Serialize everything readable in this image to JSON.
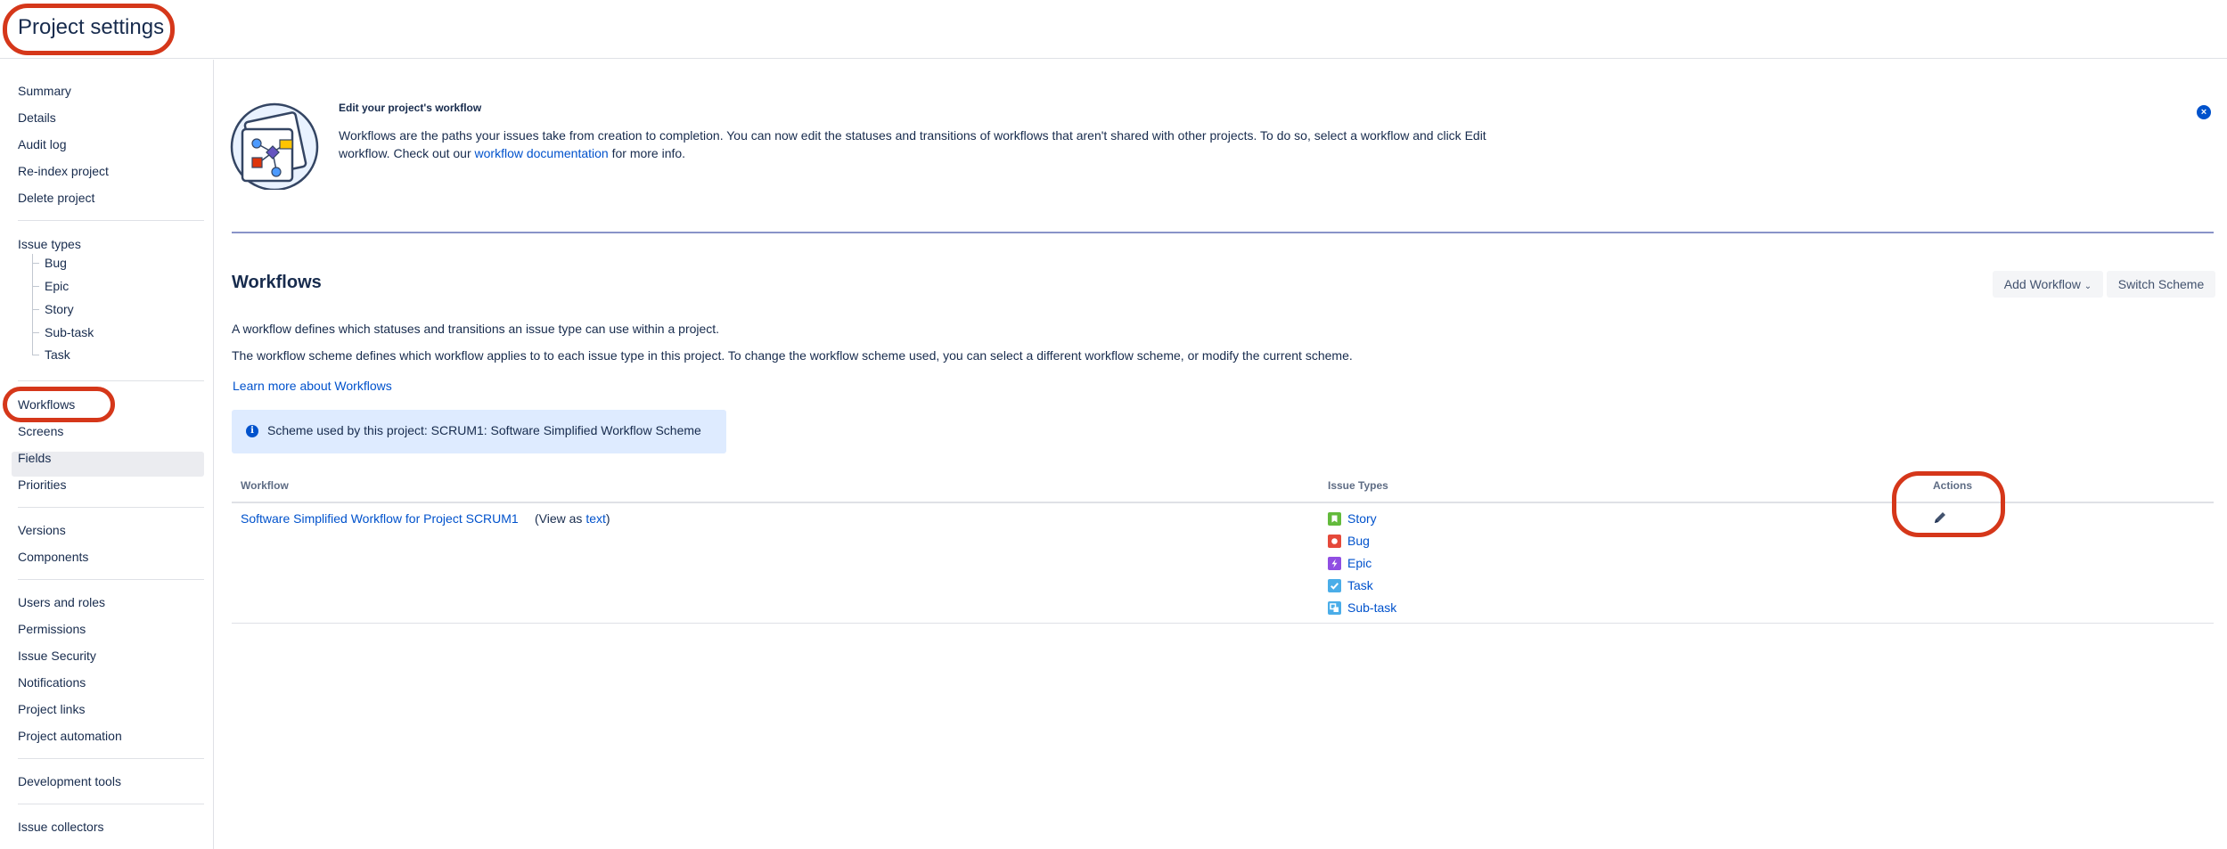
{
  "header": {
    "title": "Project settings"
  },
  "sidebar": {
    "group1": [
      "Summary",
      "Details",
      "Audit log",
      "Re-index project",
      "Delete project"
    ],
    "issue_types_label": "Issue types",
    "issue_types": [
      "Bug",
      "Epic",
      "Story",
      "Sub-task",
      "Task"
    ],
    "group3": [
      "Workflows",
      "Screens",
      "Fields",
      "Priorities"
    ],
    "group4": [
      "Versions",
      "Components"
    ],
    "group5": [
      "Users and roles",
      "Permissions",
      "Issue Security",
      "Notifications",
      "Project links",
      "Project automation"
    ],
    "group6": [
      "Development tools"
    ],
    "group7": [
      "Issue collectors"
    ],
    "active": "Workflows"
  },
  "banner": {
    "heading": "Edit your project's workflow",
    "text_before": "Workflows are the paths your issues take from creation to completion. You can now edit the statuses and transitions of workflows that aren't shared with other projects. To do so, select a workflow and click Edit workflow. Check out our ",
    "link": "workflow documentation",
    "text_after": " for more info."
  },
  "workflows": {
    "title": "Workflows",
    "add_button": "Add Workflow",
    "switch_button": "Switch Scheme",
    "para1": "A workflow defines which statuses and transitions an issue type can use within a project.",
    "para2": "The workflow scheme defines which workflow applies to to each issue type in this project. To change the workflow scheme used, you can select a different workflow scheme, or modify the current scheme.",
    "learn_more": "Learn more about Workflows",
    "scheme_prefix": "Scheme used by this project: ",
    "scheme_name": "SCRUM1: Software Simplified Workflow Scheme"
  },
  "table": {
    "headers": {
      "workflow": "Workflow",
      "issue_types": "Issue Types",
      "actions": "Actions"
    },
    "row": {
      "name": "Software Simplified Workflow for Project SCRUM1",
      "view_prefix": "(View as ",
      "view_link": "text",
      "view_suffix": ")",
      "issue_types": [
        {
          "label": "Story",
          "color": "#63ba3c",
          "icon": "story-icon"
        },
        {
          "label": "Bug",
          "color": "#e5493a",
          "icon": "bug-icon"
        },
        {
          "label": "Epic",
          "color": "#904ee2",
          "icon": "epic-icon"
        },
        {
          "label": "Task",
          "color": "#4bade8",
          "icon": "task-icon"
        },
        {
          "label": "Sub-task",
          "color": "#4bade8",
          "icon": "subtask-icon"
        }
      ]
    }
  },
  "colors": {
    "accent": "#0052cc",
    "highlight_circle": "#d5371a",
    "info_bg": "#deebff"
  }
}
